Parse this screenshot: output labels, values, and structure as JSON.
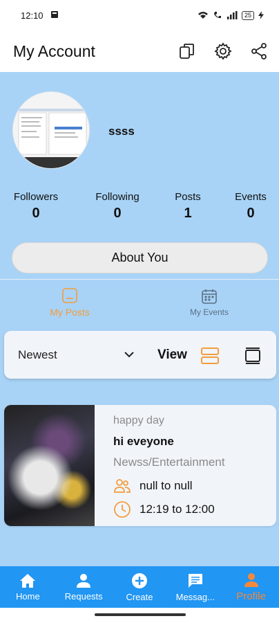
{
  "status_bar": {
    "time": "12:10",
    "battery": "25"
  },
  "app_bar": {
    "title": "My Account",
    "icons": [
      "copy-icon",
      "gear-icon",
      "share-icon"
    ]
  },
  "profile": {
    "username": "ssss",
    "stats": [
      {
        "label": "Followers",
        "value": "0"
      },
      {
        "label": "Following",
        "value": "0"
      },
      {
        "label": "Posts",
        "value": "1"
      },
      {
        "label": "Events",
        "value": "0"
      }
    ],
    "about_label": "About You"
  },
  "tabs": [
    {
      "label": "My Posts",
      "active": true
    },
    {
      "label": "My Events",
      "active": false
    }
  ],
  "filter": {
    "sort_value": "Newest",
    "view_label": "View"
  },
  "post": {
    "subtitle": "happy day",
    "title": "hi eveyone",
    "category": "Newss/Entertainment",
    "participants": "null to null",
    "time_range": "12:19 to 12:00"
  },
  "bottom_nav": [
    {
      "label": "Home",
      "icon": "home-icon"
    },
    {
      "label": "Requests",
      "icon": "person-icon"
    },
    {
      "label": "Create",
      "icon": "add-circle-icon"
    },
    {
      "label": "Messag...",
      "icon": "message-icon"
    },
    {
      "label": "Profile",
      "icon": "profile-icon",
      "active": true
    }
  ],
  "colors": {
    "accent": "#f39c3c",
    "background": "#a8d3f6",
    "nav": "#2196f3",
    "card": "#f1f5fa"
  }
}
